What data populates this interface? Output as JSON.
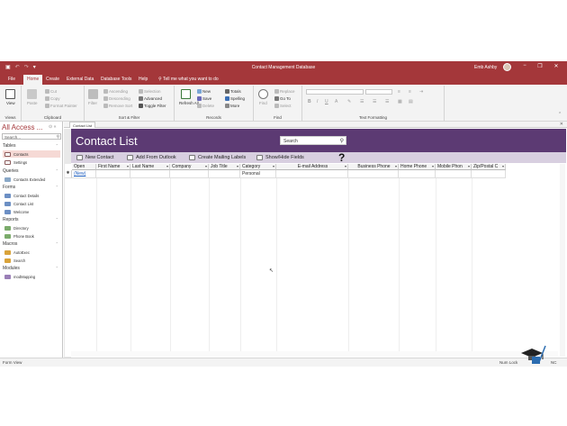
{
  "titlebar": {
    "title": "Contact Management Database",
    "user": "Emb Ashby",
    "qat": [
      "save",
      "undo",
      "redo",
      "customize"
    ],
    "minimize": "−",
    "restore": "❐",
    "close": "✕"
  },
  "menu": {
    "tabs": [
      "File",
      "Home",
      "Create",
      "External Data",
      "Database Tools",
      "Help"
    ],
    "active": "Home",
    "tell_me": "Tell me what you want to do"
  },
  "ribbon": {
    "views": {
      "label": "Views",
      "view_button": "View"
    },
    "clipboard": {
      "label": "Clipboard",
      "paste": "Paste",
      "cut": "Cut",
      "copy": "Copy",
      "format_painter": "Format Painter"
    },
    "sort_filter": {
      "label": "Sort & Filter",
      "filter": "Filter",
      "ascending": "Ascending",
      "descending": "Descending",
      "remove_sort": "Remove Sort",
      "selection": "Selection",
      "advanced": "Advanced",
      "toggle_filter": "Toggle Filter"
    },
    "records": {
      "label": "Records",
      "refresh": "Refresh All",
      "new": "New",
      "save": "Save",
      "delete": "Delete",
      "totals": "Totals",
      "spelling": "Spelling",
      "more": "More"
    },
    "find": {
      "label": "Find",
      "find": "Find",
      "replace": "Replace",
      "goto": "Go To",
      "select": "Select"
    },
    "text_formatting": {
      "label": "Text Formatting",
      "bold": "B",
      "italic": "I",
      "underline": "U"
    }
  },
  "nav": {
    "title": "All Access ...",
    "search_placeholder": "Search...",
    "groups": [
      {
        "label": "Tables",
        "items": [
          "Contacts",
          "Settings"
        ]
      },
      {
        "label": "Queries",
        "items": [
          "Contacts Extended"
        ]
      },
      {
        "label": "Forms",
        "items": [
          "Contact Details",
          "Contact List",
          "Welcome"
        ]
      },
      {
        "label": "Reports",
        "items": [
          "Directory",
          "Phone Book"
        ]
      },
      {
        "label": "Macros",
        "items": [
          "AutoExec",
          "Search"
        ]
      },
      {
        "label": "Modules",
        "items": [
          "modMapping"
        ]
      }
    ]
  },
  "document": {
    "tab_label": "Contact List",
    "form_title": "Contact List",
    "search_value": "Search",
    "commands": [
      "New Contact",
      "Add From Outlook",
      "Create Mailing Labels",
      "Show/Hide Fields"
    ],
    "help_glyph": "?"
  },
  "grid": {
    "columns": [
      "Open",
      "First Name",
      "Last Name",
      "Company",
      "Job Title",
      "Category",
      "E-mail Address",
      "Business Phone",
      "Home Phone",
      "Mobile Phon",
      "Zip/Postal C"
    ],
    "row_selector": "✱",
    "new_row": {
      "open": "(New)",
      "category": "Personal"
    }
  },
  "status": {
    "left": "Form View",
    "right": "Num Lock",
    "num": "NC"
  },
  "colors": {
    "accent": "#a4373a",
    "form_header": "#5c3a73",
    "command_bar": "#d8cfe0",
    "link": "#1f5fbf"
  }
}
